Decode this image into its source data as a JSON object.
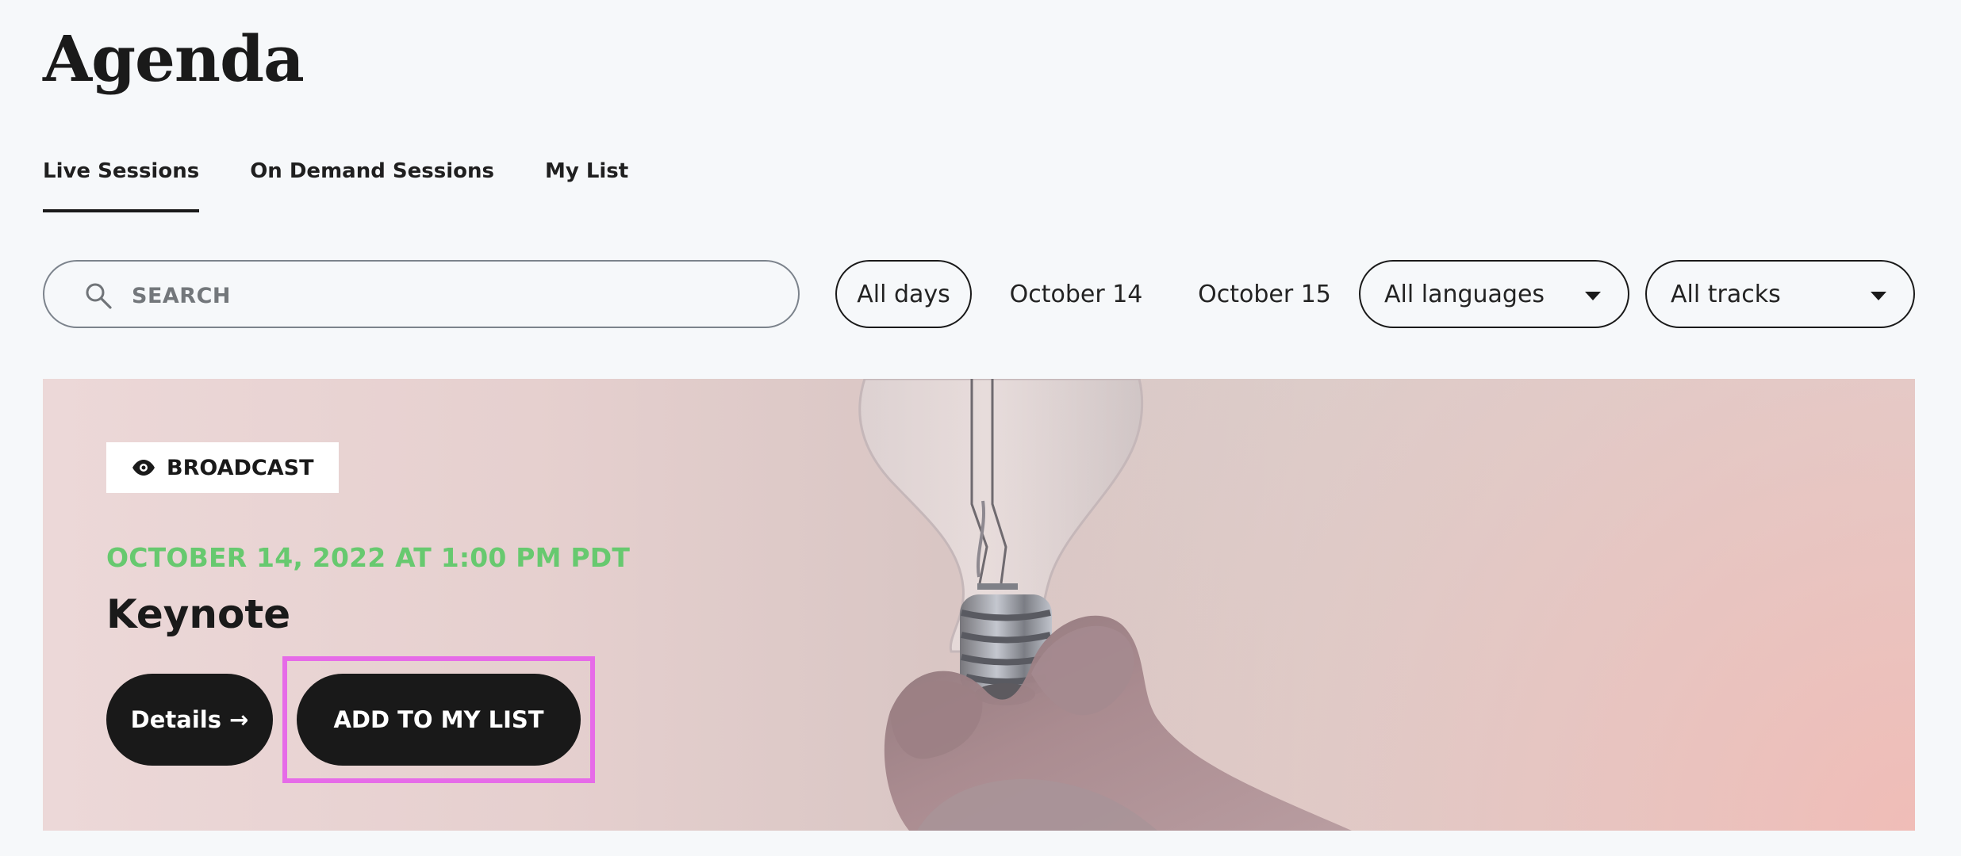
{
  "page": {
    "title": "Agenda"
  },
  "tabs": [
    {
      "label": "Live Sessions",
      "active": true
    },
    {
      "label": "On Demand Sessions",
      "active": false
    },
    {
      "label": "My List",
      "active": false
    }
  ],
  "filters": {
    "search_placeholder": "SEARCH",
    "search_value": "",
    "days": [
      {
        "label": "All days",
        "selected": true
      },
      {
        "label": "October 14",
        "selected": false
      },
      {
        "label": "October 15",
        "selected": false
      }
    ],
    "language_select": "All languages",
    "track_select": "All tracks"
  },
  "featured_session": {
    "badge": "BROADCAST",
    "date": "OCTOBER 14, 2022 AT 1:00 PM PDT",
    "title": "Keynote",
    "details_label": "Details",
    "add_label": "ADD TO MY LIST"
  },
  "icons": {
    "search": "search-icon",
    "badge": "eye-icon",
    "details_arrow": "arrow-right-icon",
    "dropdown": "chevron-down-icon"
  },
  "colors": {
    "background": "#f6f8fa",
    "text": "#1a1a1a",
    "accent_green": "#67c96f",
    "button_dark": "#191919",
    "highlight": "#e66be8"
  }
}
